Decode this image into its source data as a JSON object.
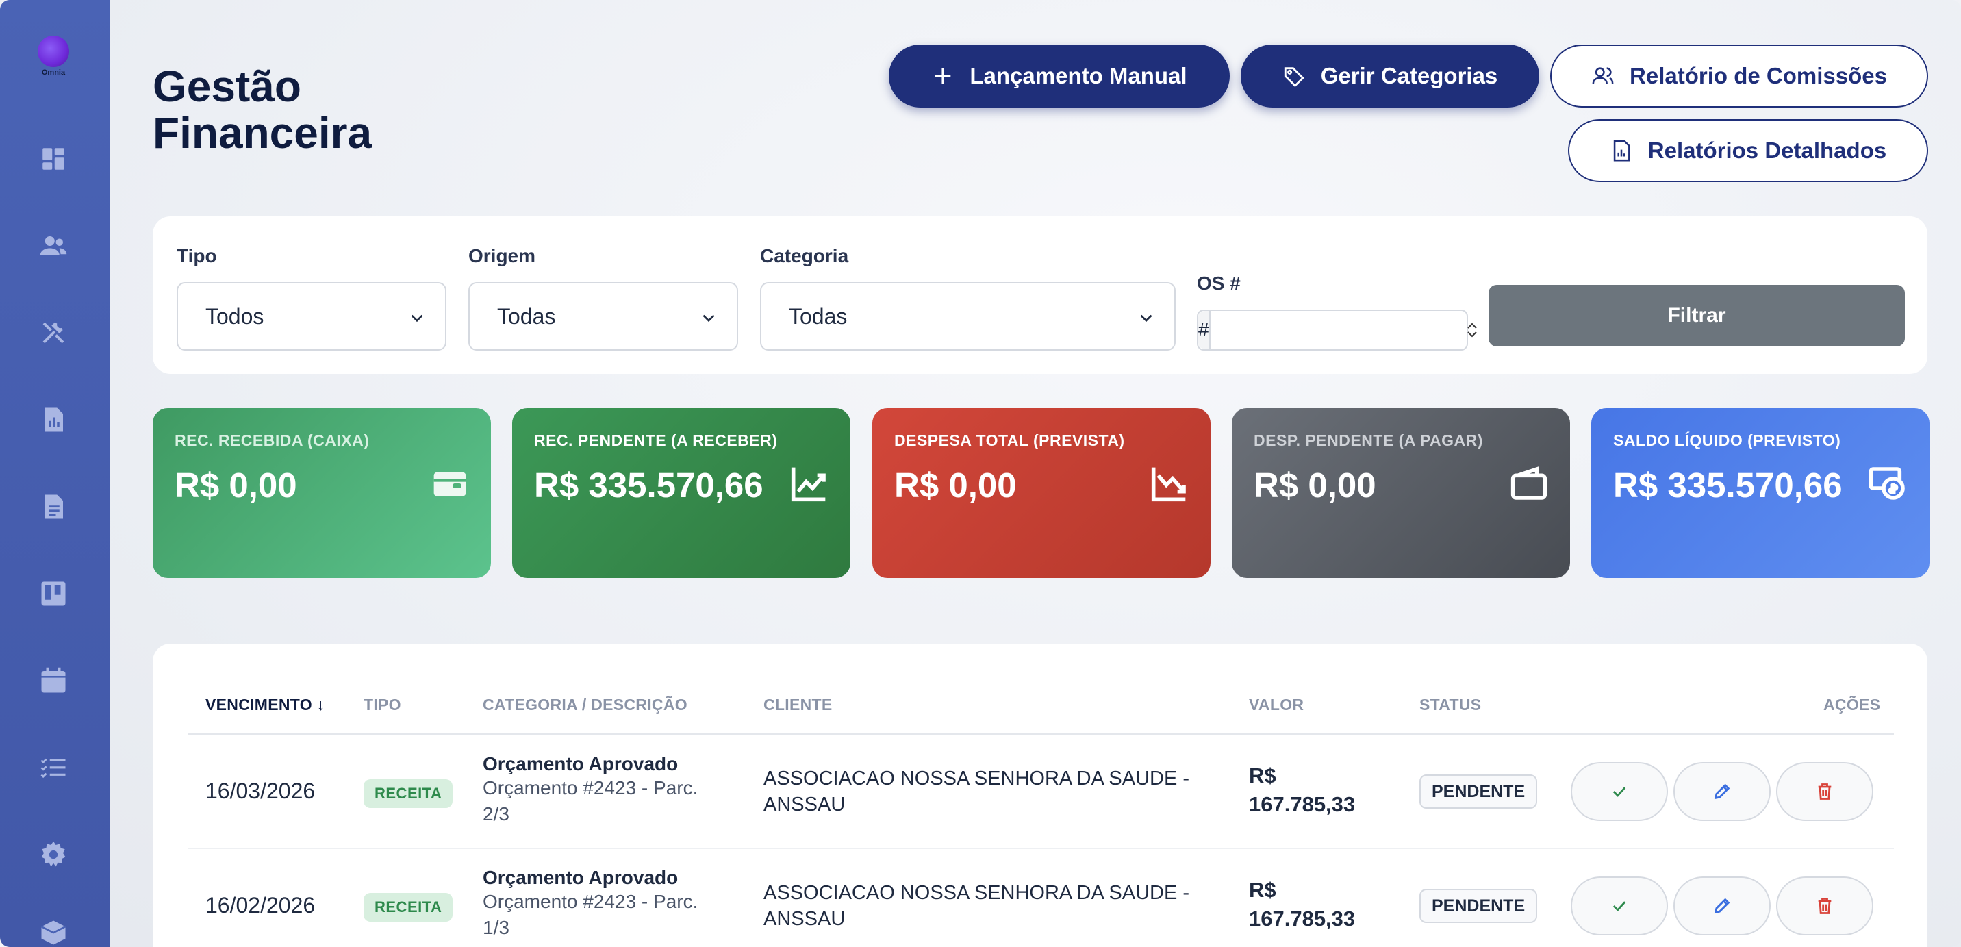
{
  "sidebar": {
    "logo_text": "Omnia",
    "icons": [
      "dashboard-icon",
      "users-icon",
      "tools-icon",
      "report-icon",
      "document-icon",
      "kanban-icon",
      "calendar-icon",
      "checklist-icon",
      "gear-icon",
      "box-icon"
    ]
  },
  "header": {
    "title_line1": "Gestão",
    "title_line2": "Financeira",
    "buttons": {
      "manual": "Lançamento Manual",
      "categories": "Gerir Categorias",
      "commissions": "Relatório de Comissões",
      "detailed": "Relatórios Detalhados"
    }
  },
  "filters": {
    "tipo_label": "Tipo",
    "tipo_value": "Todos",
    "origem_label": "Origem",
    "origem_value": "Todas",
    "categoria_label": "Categoria",
    "categoria_value": "Todas",
    "os_label": "OS #",
    "os_prefix": "#",
    "os_value": "",
    "submit_label": "Filtrar"
  },
  "stats": [
    {
      "label": "REC. RECEBIDA (CAIXA)",
      "value": "R$ 0,00",
      "icon": "wallet-icon"
    },
    {
      "label": "REC. PENDENTE (A RECEBER)",
      "value": "R$ 335.570,66",
      "icon": "trend-up-icon"
    },
    {
      "label": "DESPESA TOTAL (PREVISTA)",
      "value": "R$ 0,00",
      "icon": "trend-down-icon"
    },
    {
      "label": "DESP. PENDENTE (A PAGAR)",
      "value": "R$ 0,00",
      "icon": "wallet-icon"
    },
    {
      "label": "SALDO LÍQUIDO (PREVISTO)",
      "value": "R$ 335.570,66",
      "icon": "cash-icon"
    }
  ],
  "table": {
    "headers": {
      "vencimento": "VENCIMENTO",
      "sort_arrow": "↓",
      "tipo": "TIPO",
      "categoria": "CATEGORIA / DESCRIÇÃO",
      "cliente": "CLIENTE",
      "valor": "VALOR",
      "status": "STATUS",
      "acoes": "AÇÕES"
    },
    "rows": [
      {
        "date": "16/03/2026",
        "tipo": "RECEITA",
        "cat_title": "Orçamento Aprovado",
        "cat_line1": "Orçamento #2423 - Parc.",
        "cat_line2": "2/3",
        "client_line1": "ASSOCIACAO NOSSA SENHORA DA SAUDE -",
        "client_line2": "ANSSAU",
        "valor_line1": "R$",
        "valor_line2": "167.785,33",
        "status": "PENDENTE"
      },
      {
        "date": "16/02/2026",
        "tipo": "RECEITA",
        "cat_title": "Orçamento Aprovado",
        "cat_line1": "Orçamento #2423 - Parc.",
        "cat_line2": "1/3",
        "client_line1": "ASSOCIACAO NOSSA SENHORA DA SAUDE -",
        "client_line2": "ANSSAU",
        "valor_line1": "R$",
        "valor_line2": "167.785,33",
        "status": "PENDENTE"
      }
    ]
  }
}
